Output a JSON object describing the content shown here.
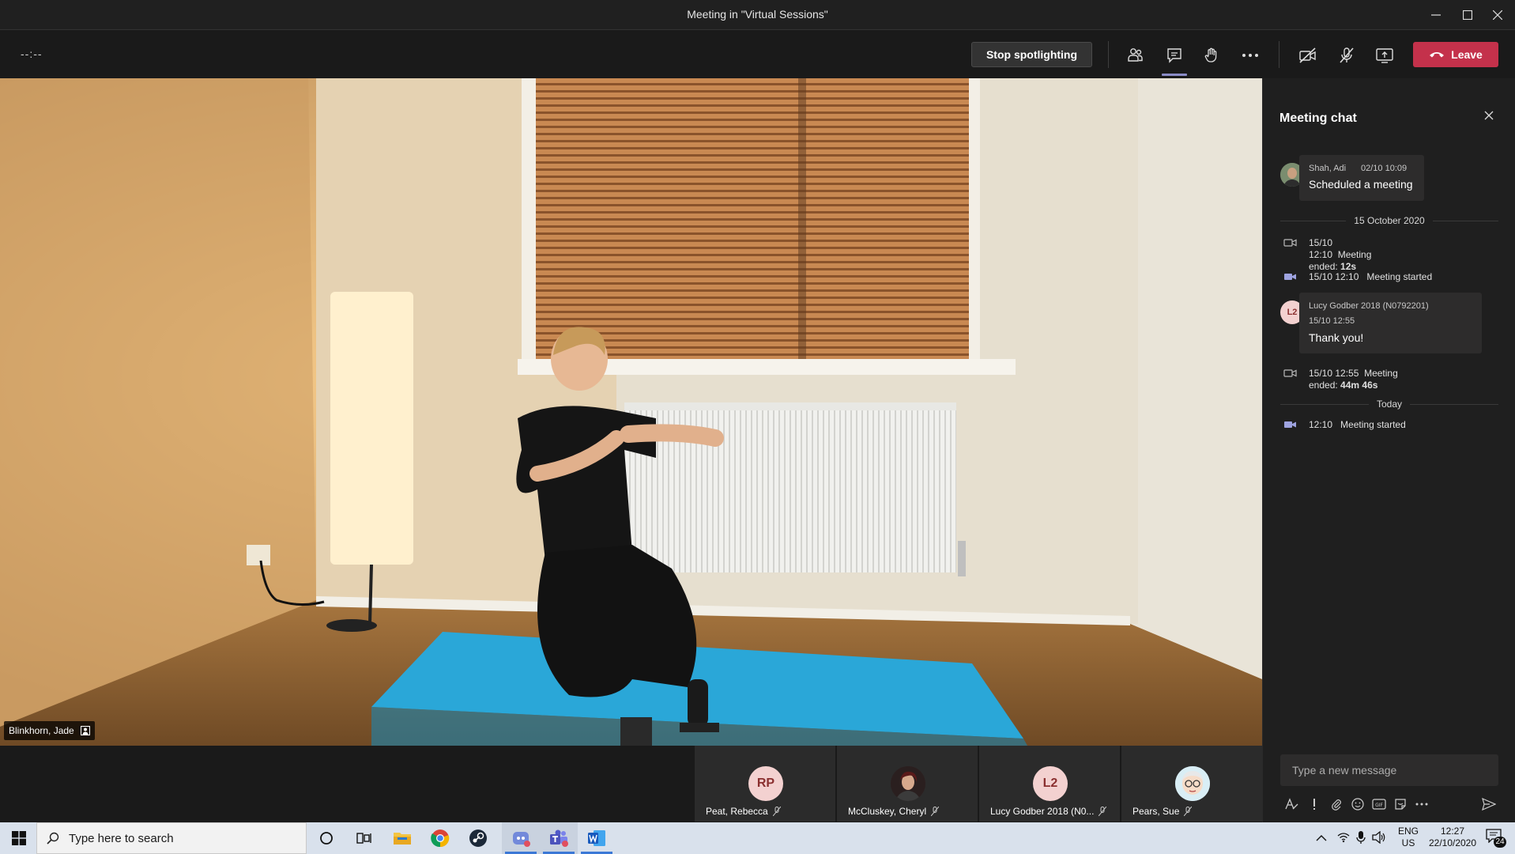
{
  "window": {
    "title": "Meeting in \"Virtual Sessions\""
  },
  "toolbar": {
    "timer": "--:--",
    "spotlight_label": "Stop spotlighting",
    "leave_label": "Leave",
    "accent": "#8b8cc7",
    "leave_color": "#c4314b"
  },
  "video": {
    "speaker_name": "Blinkhorn, Jade"
  },
  "participants": [
    {
      "initials": "RP",
      "name": "Peat, Rebecca",
      "avatar": "initials"
    },
    {
      "initials": "",
      "name": "McCluskey, Cheryl",
      "avatar": "photo"
    },
    {
      "initials": "L2",
      "name": "Lucy Godber 2018 (N0...",
      "avatar": "initials"
    },
    {
      "initials": "",
      "name": "Pears, Sue",
      "avatar": "cartoon"
    }
  ],
  "chat": {
    "title": "Meeting chat",
    "messages": [
      {
        "type": "message",
        "author": "Shah, Adi",
        "time": "02/10 10:09",
        "text": "Scheduled a meeting",
        "avatar": "photo"
      },
      {
        "type": "divider",
        "label": "15 October 2020"
      },
      {
        "type": "system",
        "time": "15/10 12:10",
        "text": "Meeting ended:",
        "duration": "12s",
        "icon": "call-ended-icon"
      },
      {
        "type": "system",
        "time": "15/10 12:10",
        "text": "Meeting started",
        "icon": "call-started-icon"
      },
      {
        "type": "message",
        "author": "Lucy Godber 2018 (N0792201)",
        "time": "15/10 12:55",
        "text": "Thank you!",
        "initials": "L2"
      },
      {
        "type": "system",
        "time": "15/10 12:55",
        "text": "Meeting ended:",
        "duration": "44m 46s",
        "icon": "call-ended-icon"
      },
      {
        "type": "divider",
        "label": "Today"
      },
      {
        "type": "system",
        "time": "12:10",
        "text": "Meeting started",
        "icon": "call-started-icon"
      }
    ],
    "compose_placeholder": "Type a new message"
  },
  "taskbar": {
    "search_placeholder": "Type here to search",
    "lang_top": "ENG",
    "lang_bottom": "US",
    "time": "12:27",
    "date": "22/10/2020",
    "notifications": "24"
  }
}
